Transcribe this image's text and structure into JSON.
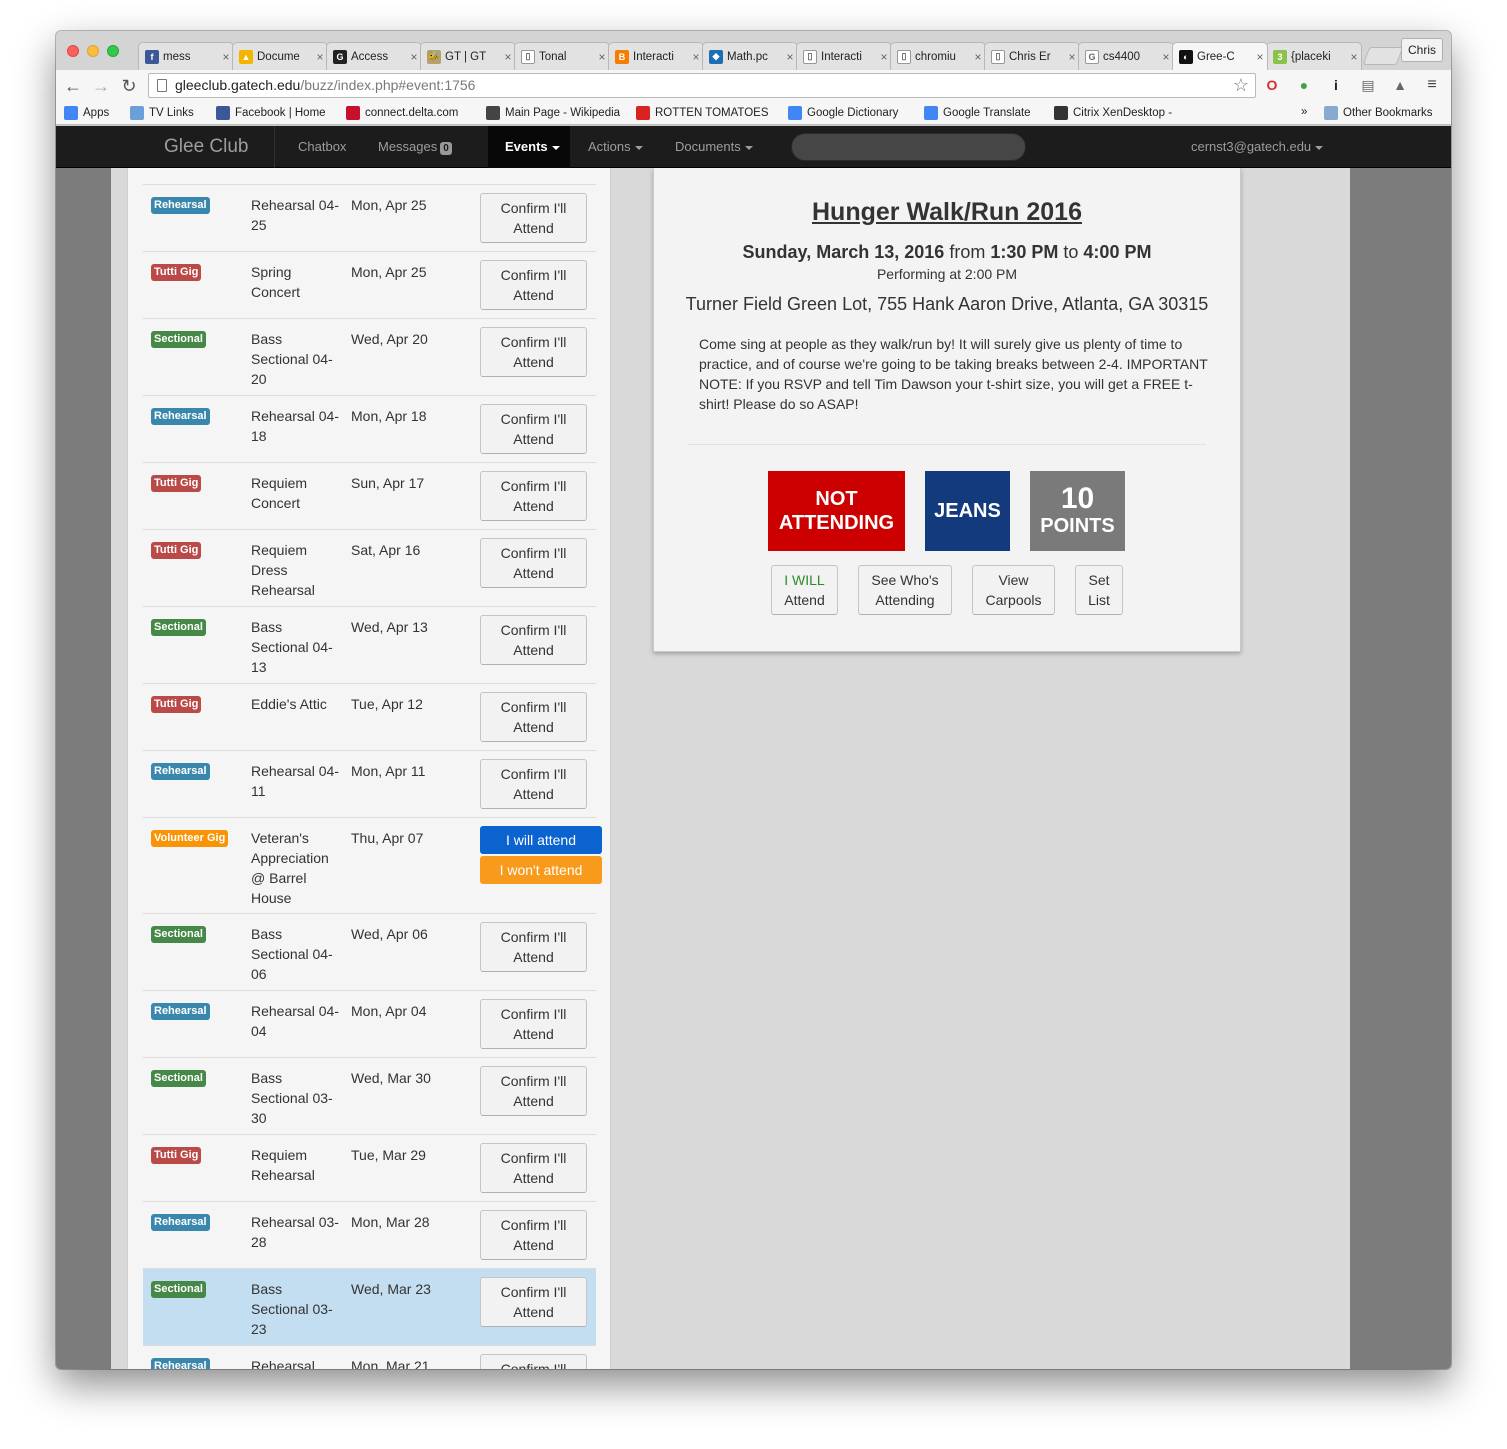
{
  "browser": {
    "tabs": [
      {
        "title": "mess",
        "favicon_color": "#3b5998",
        "favicon_glyph": "f"
      },
      {
        "title": "Docume",
        "favicon_color": "#f4b400",
        "favicon_glyph": "▲"
      },
      {
        "title": "Access",
        "favicon_color": "#222222",
        "favicon_glyph": "G"
      },
      {
        "title": "GT | GT",
        "favicon_color": "#b3a369",
        "favicon_glyph": "🐝"
      },
      {
        "title": "Tonal",
        "favicon_color": "#ffffff",
        "favicon_glyph": "▯"
      },
      {
        "title": "Interacti",
        "favicon_color": "#f57d00",
        "favicon_glyph": "B"
      },
      {
        "title": "Math.pc",
        "favicon_color": "#1c6fb5",
        "favicon_glyph": "◆"
      },
      {
        "title": "Interacti",
        "favicon_color": "#ffffff",
        "favicon_glyph": "▯"
      },
      {
        "title": "chromiu",
        "favicon_color": "#ffffff",
        "favicon_glyph": "▯"
      },
      {
        "title": "Chris Er",
        "favicon_color": "#ffffff",
        "favicon_glyph": "▯"
      },
      {
        "title": "cs4400",
        "favicon_color": "#ffffff",
        "favicon_glyph": "G"
      },
      {
        "title": "Gree-C",
        "favicon_color": "#111111",
        "favicon_glyph": "◐"
      },
      {
        "title": "{placeki",
        "favicon_color": "#8bc34a",
        "favicon_glyph": "3"
      }
    ],
    "profile_name": "Chris",
    "url_host": "gleeclub.gatech.edu",
    "url_path": "/buzz/index.php#event:1756",
    "bookmarks": [
      {
        "label": "Apps",
        "color": "#4285f4"
      },
      {
        "label": "TV Links",
        "color": "#6aa0d8"
      },
      {
        "label": "Facebook | Home",
        "color": "#3b5998"
      },
      {
        "label": "connect.delta.com",
        "color": "#c8102e"
      },
      {
        "label": "Main Page - Wikipedia",
        "color": "#444444"
      },
      {
        "label": "ROTTEN TOMATOES",
        "color": "#d92323"
      },
      {
        "label": "Google Dictionary",
        "color": "#4285f4"
      },
      {
        "label": "Google Translate",
        "color": "#4285f4"
      },
      {
        "label": "Citrix XenDesktop - ",
        "color": "#333333"
      }
    ],
    "bookmarks_overflow": "»",
    "other_bookmarks": "Other Bookmarks"
  },
  "site": {
    "brand": "Glee Club",
    "nav": {
      "chatbox": "Chatbox",
      "messages": "Messages",
      "messages_count": "0",
      "events": "Events",
      "actions": "Actions",
      "documents": "Documents",
      "user": "cernst3@gatech.edu"
    }
  },
  "events": [
    {
      "type": "Rehearsal",
      "kind": "reh",
      "name": "Rehearsal 04-25",
      "date": "Mon, Apr 25",
      "action": "Confirm I'll Attend"
    },
    {
      "type": "Tutti Gig",
      "kind": "tut",
      "name": "Spring Concert",
      "date": "Mon, Apr 25",
      "action": "Confirm I'll Attend"
    },
    {
      "type": "Sectional",
      "kind": "sec",
      "name": "Bass Sectional 04-20",
      "date": "Wed, Apr 20",
      "action": "Confirm I'll Attend"
    },
    {
      "type": "Rehearsal",
      "kind": "reh",
      "name": "Rehearsal 04-18",
      "date": "Mon, Apr 18",
      "action": "Confirm I'll Attend"
    },
    {
      "type": "Tutti Gig",
      "kind": "tut",
      "name": "Requiem Concert",
      "date": "Sun, Apr 17",
      "action": "Confirm I'll Attend"
    },
    {
      "type": "Tutti Gig",
      "kind": "tut",
      "name": "Requiem Dress Rehearsal",
      "date": "Sat, Apr 16",
      "action": "Confirm I'll Attend"
    },
    {
      "type": "Sectional",
      "kind": "sec",
      "name": "Bass Sectional 04-13",
      "date": "Wed, Apr 13",
      "action": "Confirm I'll Attend"
    },
    {
      "type": "Tutti Gig",
      "kind": "tut",
      "name": "Eddie's Attic",
      "date": "Tue, Apr 12",
      "action": "Confirm I'll Attend"
    },
    {
      "type": "Rehearsal",
      "kind": "reh",
      "name": "Rehearsal 04-11",
      "date": "Mon, Apr 11",
      "action": "Confirm I'll Attend"
    },
    {
      "type": "Volunteer Gig",
      "kind": "vol",
      "name": "Veteran's Appreciation @ Barrel House",
      "date": "Thu, Apr 07",
      "will": "I will attend",
      "wont": "I won't attend"
    },
    {
      "type": "Sectional",
      "kind": "sec",
      "name": "Bass Sectional 04-06",
      "date": "Wed, Apr 06",
      "action": "Confirm I'll Attend"
    },
    {
      "type": "Rehearsal",
      "kind": "reh",
      "name": "Rehearsal 04-04",
      "date": "Mon, Apr 04",
      "action": "Confirm I'll Attend"
    },
    {
      "type": "Sectional",
      "kind": "sec",
      "name": "Bass Sectional 03-30",
      "date": "Wed, Mar 30",
      "action": "Confirm I'll Attend"
    },
    {
      "type": "Tutti Gig",
      "kind": "tut",
      "name": "Requiem Rehearsal",
      "date": "Tue, Mar 29",
      "action": "Confirm I'll Attend"
    },
    {
      "type": "Rehearsal",
      "kind": "reh",
      "name": "Rehearsal 03-28",
      "date": "Mon, Mar 28",
      "action": "Confirm I'll Attend"
    },
    {
      "type": "Sectional",
      "kind": "sec",
      "name": "Bass Sectional 03-23",
      "date": "Wed, Mar 23",
      "action": "Confirm I'll Attend",
      "selected": true
    },
    {
      "type": "Rehearsal",
      "kind": "reh",
      "name": "Rehearsal",
      "date": "Mon, Mar 21",
      "action": "Confirm I'll"
    }
  ],
  "detail": {
    "title": "Hunger Walk/Run 2016",
    "date": "Sunday, March 13, 2016",
    "from_word": "from",
    "start_time": "1:30 PM",
    "to_word": "to",
    "end_time": "4:00 PM",
    "performing": "Performing at 2:00 PM",
    "location": "Turner Field Green Lot, 755 Hank Aaron Drive, Atlanta, GA 30315",
    "description": "Come sing at people as they walk/run by! It will surely give us plenty of time to practice, and of course we're going to be taking breaks between 2-4. IMPORTANT NOTE: If you RSVP and tell Tim Dawson your t-shirt size, you will get a FREE t-shirt! Please do so ASAP!",
    "status_line1": "NOT",
    "status_line2": "ATTENDING",
    "uniform": "JEANS",
    "points_value": "10",
    "points_label": "POINTS",
    "btn_will_1": "I WILL",
    "btn_will_2": "Attend",
    "btn_who_1": "See Who's",
    "btn_who_2": "Attending",
    "btn_carpool_1": "View",
    "btn_carpool_2": "Carpools",
    "btn_setlist_1": "Set",
    "btn_setlist_2": "List"
  }
}
